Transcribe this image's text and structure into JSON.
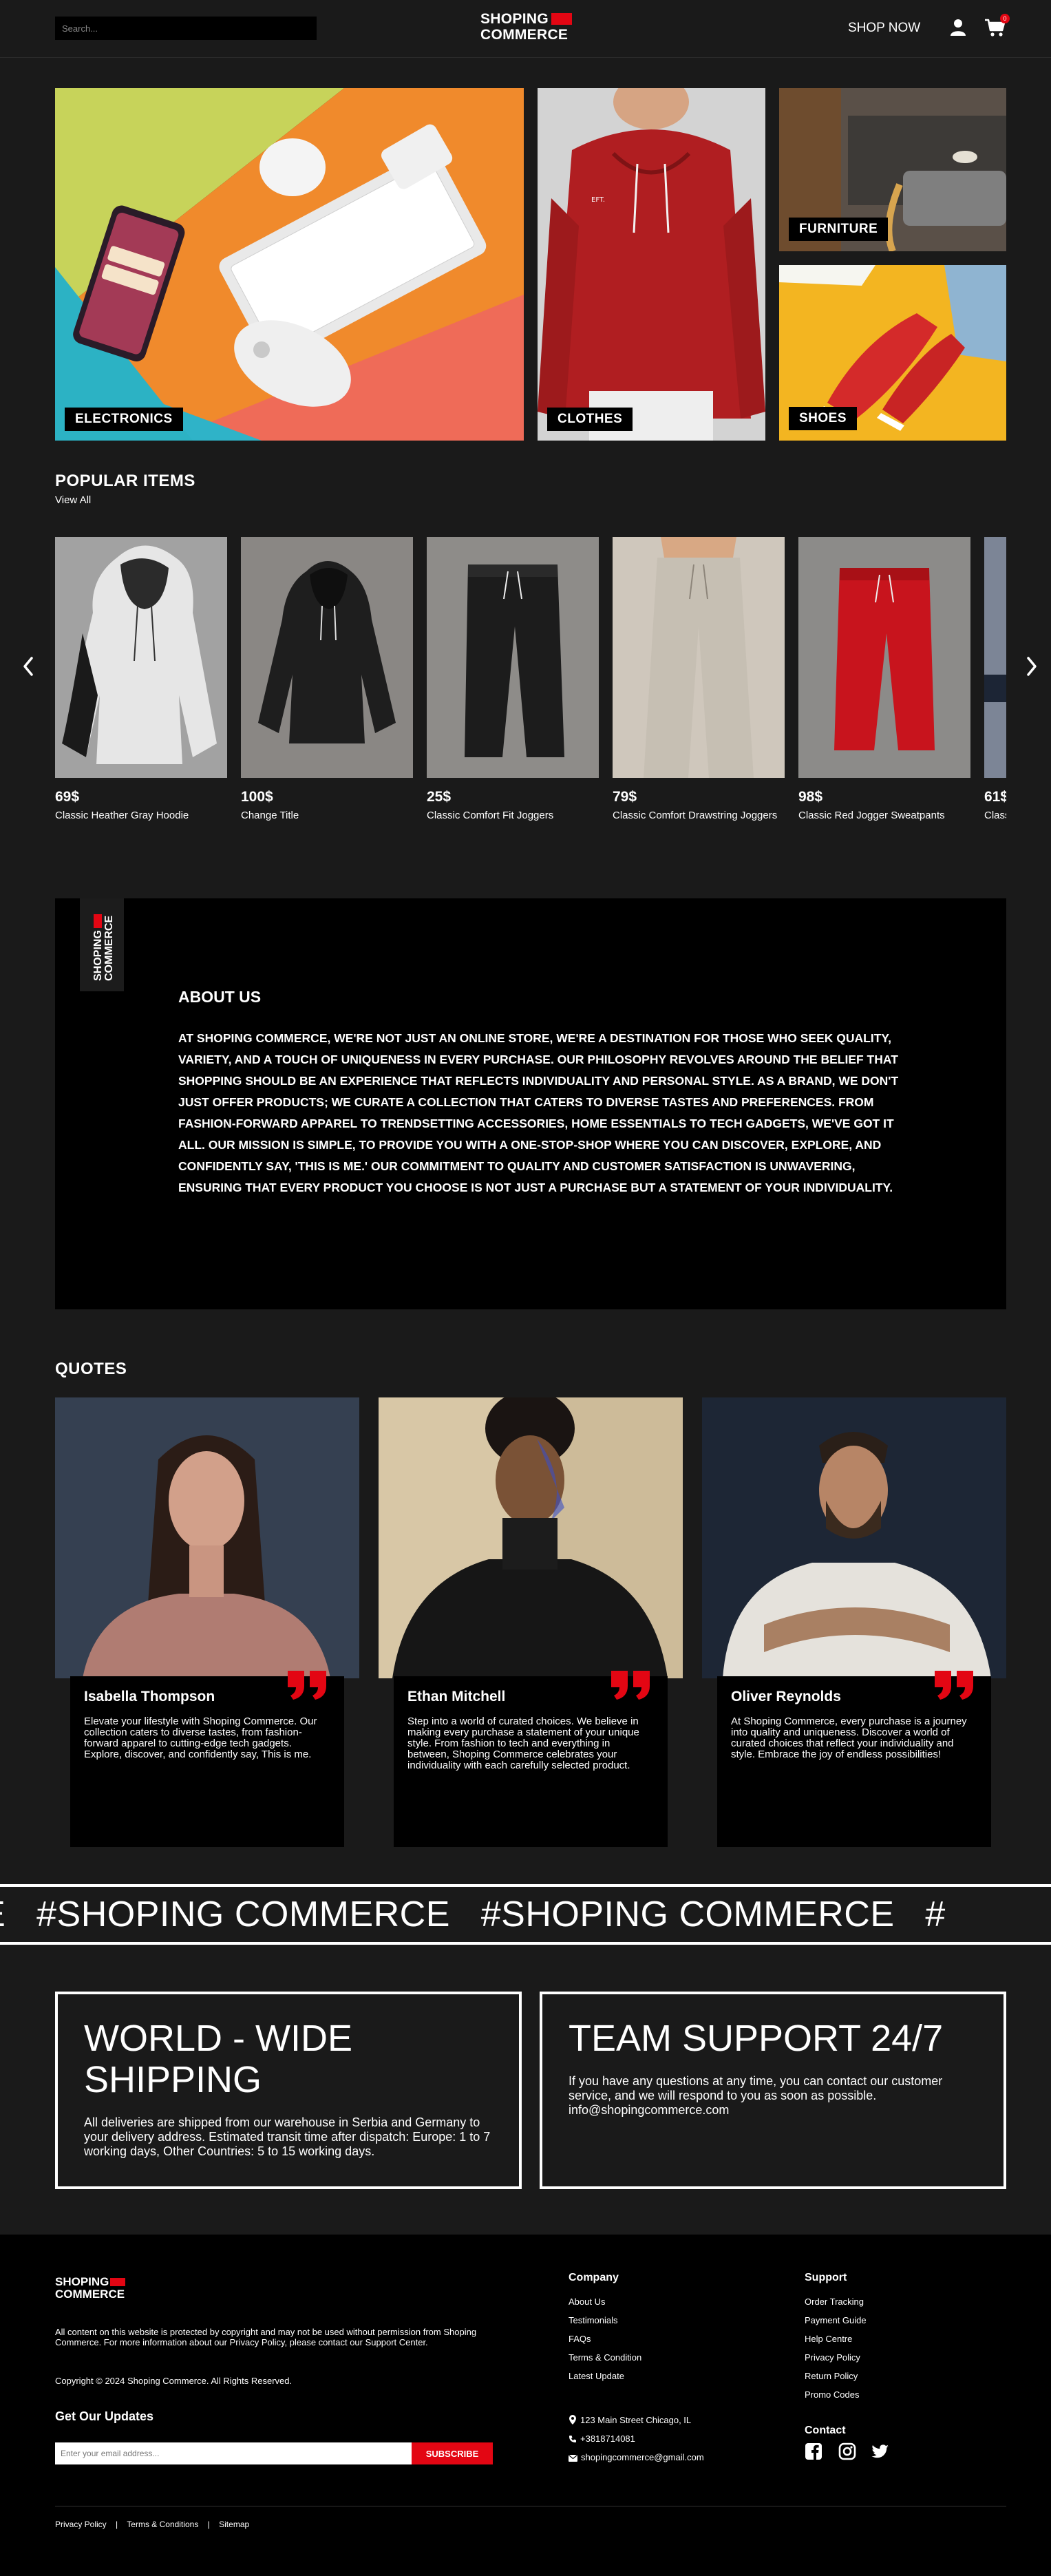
{
  "header": {
    "search_placeholder": "Search...",
    "logo_line1": "SHOPING",
    "logo_line2": "COMMERCE",
    "shop_now": "SHOP NOW",
    "cart_count": "0"
  },
  "hero": {
    "electronics": "ELECTRONICS",
    "clothes": "CLOTHES",
    "furniture": "FURNITURE",
    "shoes": "SHOES"
  },
  "popular": {
    "title": "POPULAR ITEMS",
    "view_all": "View All",
    "items": [
      {
        "price": "69$",
        "name": "Classic Heather Gray Hoodie"
      },
      {
        "price": "100$",
        "name": "Change Title"
      },
      {
        "price": "25$",
        "name": "Classic Comfort Fit Joggers"
      },
      {
        "price": "79$",
        "name": "Classic Comfort Drawstring Joggers"
      },
      {
        "price": "98$",
        "name": "Classic Red Jogger Sweatpants"
      },
      {
        "price": "61$",
        "name": "Classic"
      }
    ]
  },
  "about": {
    "logo_line1": "SHOPING",
    "logo_line2": "COMMERCE",
    "title": "ABOUT US",
    "text": "AT SHOPING COMMERCE, WE'RE NOT JUST AN ONLINE STORE, WE'RE A DESTINATION FOR THOSE WHO SEEK QUALITY, VARIETY, AND A TOUCH OF UNIQUENESS IN EVERY PURCHASE. OUR PHILOSOPHY REVOLVES AROUND THE BELIEF THAT SHOPPING SHOULD BE AN EXPERIENCE THAT REFLECTS INDIVIDUALITY AND PERSONAL STYLE. AS A BRAND, WE DON'T JUST OFFER PRODUCTS; WE CURATE A COLLECTION THAT CATERS TO DIVERSE TASTES AND PREFERENCES. FROM FASHION-FORWARD APPAREL TO TRENDSETTING ACCESSORIES, HOME ESSENTIALS TO TECH GADGETS, WE'VE GOT IT ALL. OUR MISSION IS SIMPLE, TO PROVIDE YOU WITH A ONE-STOP-SHOP WHERE YOU CAN DISCOVER, EXPLORE, AND CONFIDENTLY SAY, 'THIS IS ME.' OUR COMMITMENT TO QUALITY AND CUSTOMER SATISFACTION IS UNWAVERING, ENSURING THAT EVERY PRODUCT YOU CHOOSE IS NOT JUST A PURCHASE BUT A STATEMENT OF YOUR INDIVIDUALITY."
  },
  "quotes": {
    "title": "QUOTES",
    "items": [
      {
        "name": "Isabella Thompson",
        "text": "Elevate your lifestyle with Shoping Commerce. Our collection caters to diverse tastes, from fashion-forward apparel to cutting-edge tech gadgets. Explore, discover, and confidently say, This is me."
      },
      {
        "name": "Ethan Mitchell",
        "text": "Step into a world of curated choices. We believe in making every purchase a statement of your unique style. From fashion to tech and everything in between, Shoping Commerce celebrates your individuality with each carefully selected product."
      },
      {
        "name": "Oliver Reynolds",
        "text": "At Shoping Commerce, every purchase is a journey into quality and uniqueness. Discover a world of curated choices that reflect your individuality and style. Embrace the joy of endless possibilities!"
      }
    ]
  },
  "marquee": {
    "text": "RCE   #SHOPING COMMERCE   #SHOPING COMMERCE   #"
  },
  "info": {
    "shipping_title": "WORLD - WIDE SHIPPING",
    "shipping_text": "All deliveries are shipped from our warehouse in Serbia and Germany to your delivery address. Estimated transit time after dispatch: Europe: 1 to 7 working days, Other Countries: 5 to 15 working days.",
    "support_title": "TEAM SUPPORT 24/7",
    "support_text": "If you have any questions at any time, you can contact our customer service, and we will respond to you as soon as possible. info@shopingcommerce.com"
  },
  "footer": {
    "logo_line1": "SHOPING",
    "logo_line2": "COMMERCE",
    "disclaimer": "All content on this website is protected by copyright and may not be used without permission from Shoping Commerce. For more information about our Privacy Policy, please contact our Support Center.",
    "copyright": "Copyright © 2024 Shoping Commerce. All Rights Reserved.",
    "updates_title": "Get Our Updates",
    "email_placeholder": "Enter your email address...",
    "subscribe": "SUBSCRIBE",
    "company_title": "Company",
    "company_links": [
      "About Us",
      "Testimonials",
      "FAQs",
      "Terms & Condition",
      "Latest Update"
    ],
    "support_title": "Support",
    "support_links": [
      "Order Tracking",
      "Payment Guide",
      "Help Centre",
      "Privacy Policy",
      "Return Policy",
      "Promo Codes"
    ],
    "address": "123 Main Street Chicago, IL",
    "phone": "+3818714081",
    "email": "shopingcommerce@gmail.com",
    "contact_title": "Contact",
    "bottom_links": [
      "Privacy Policy",
      "Terms & Conditions",
      "Sitemap"
    ],
    "separator": "|"
  }
}
